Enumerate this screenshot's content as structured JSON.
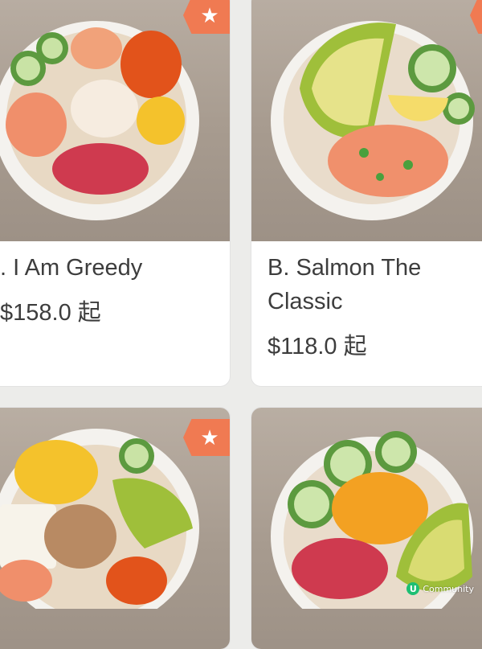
{
  "items": [
    {
      "name": ". I Am Greedy",
      "price": "$158.0 起",
      "badge_icon": "star-icon",
      "featured": true
    },
    {
      "name": "B. Salmon The Classic",
      "price": "$118.0 起",
      "badge_icon": "star-icon",
      "featured": true
    },
    {
      "name": "",
      "price": "",
      "badge_icon": "star-icon",
      "featured": true
    },
    {
      "name": "",
      "price": "",
      "badge_icon": "",
      "featured": false
    }
  ],
  "badge_star": "★",
  "watermark": {
    "logo_letter": "U",
    "text": "Community"
  },
  "colors": {
    "badge": "#f07a52",
    "text": "#3d3d3d",
    "card": "#ffffff"
  }
}
